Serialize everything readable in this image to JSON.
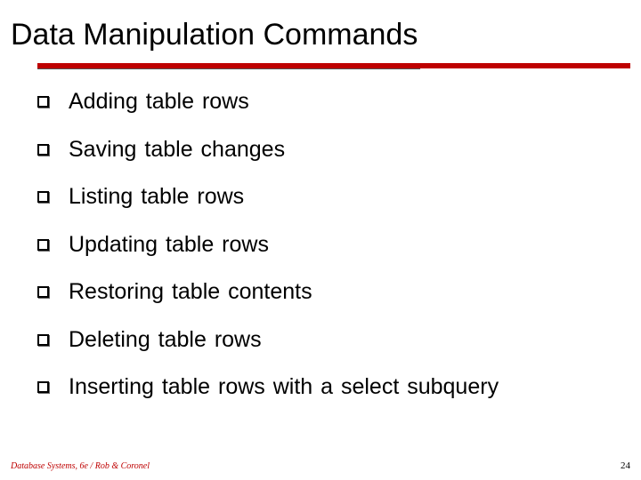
{
  "title": "Data Manipulation Commands",
  "bullets": [
    "Adding table rows",
    "Saving table changes",
    "Listing table rows",
    "Updating table rows",
    "Restoring table contents",
    "Deleting table rows",
    "Inserting table rows with a select subquery"
  ],
  "footer": {
    "source": "Database Systems, 6e / Rob & Coronel",
    "page": "24"
  }
}
